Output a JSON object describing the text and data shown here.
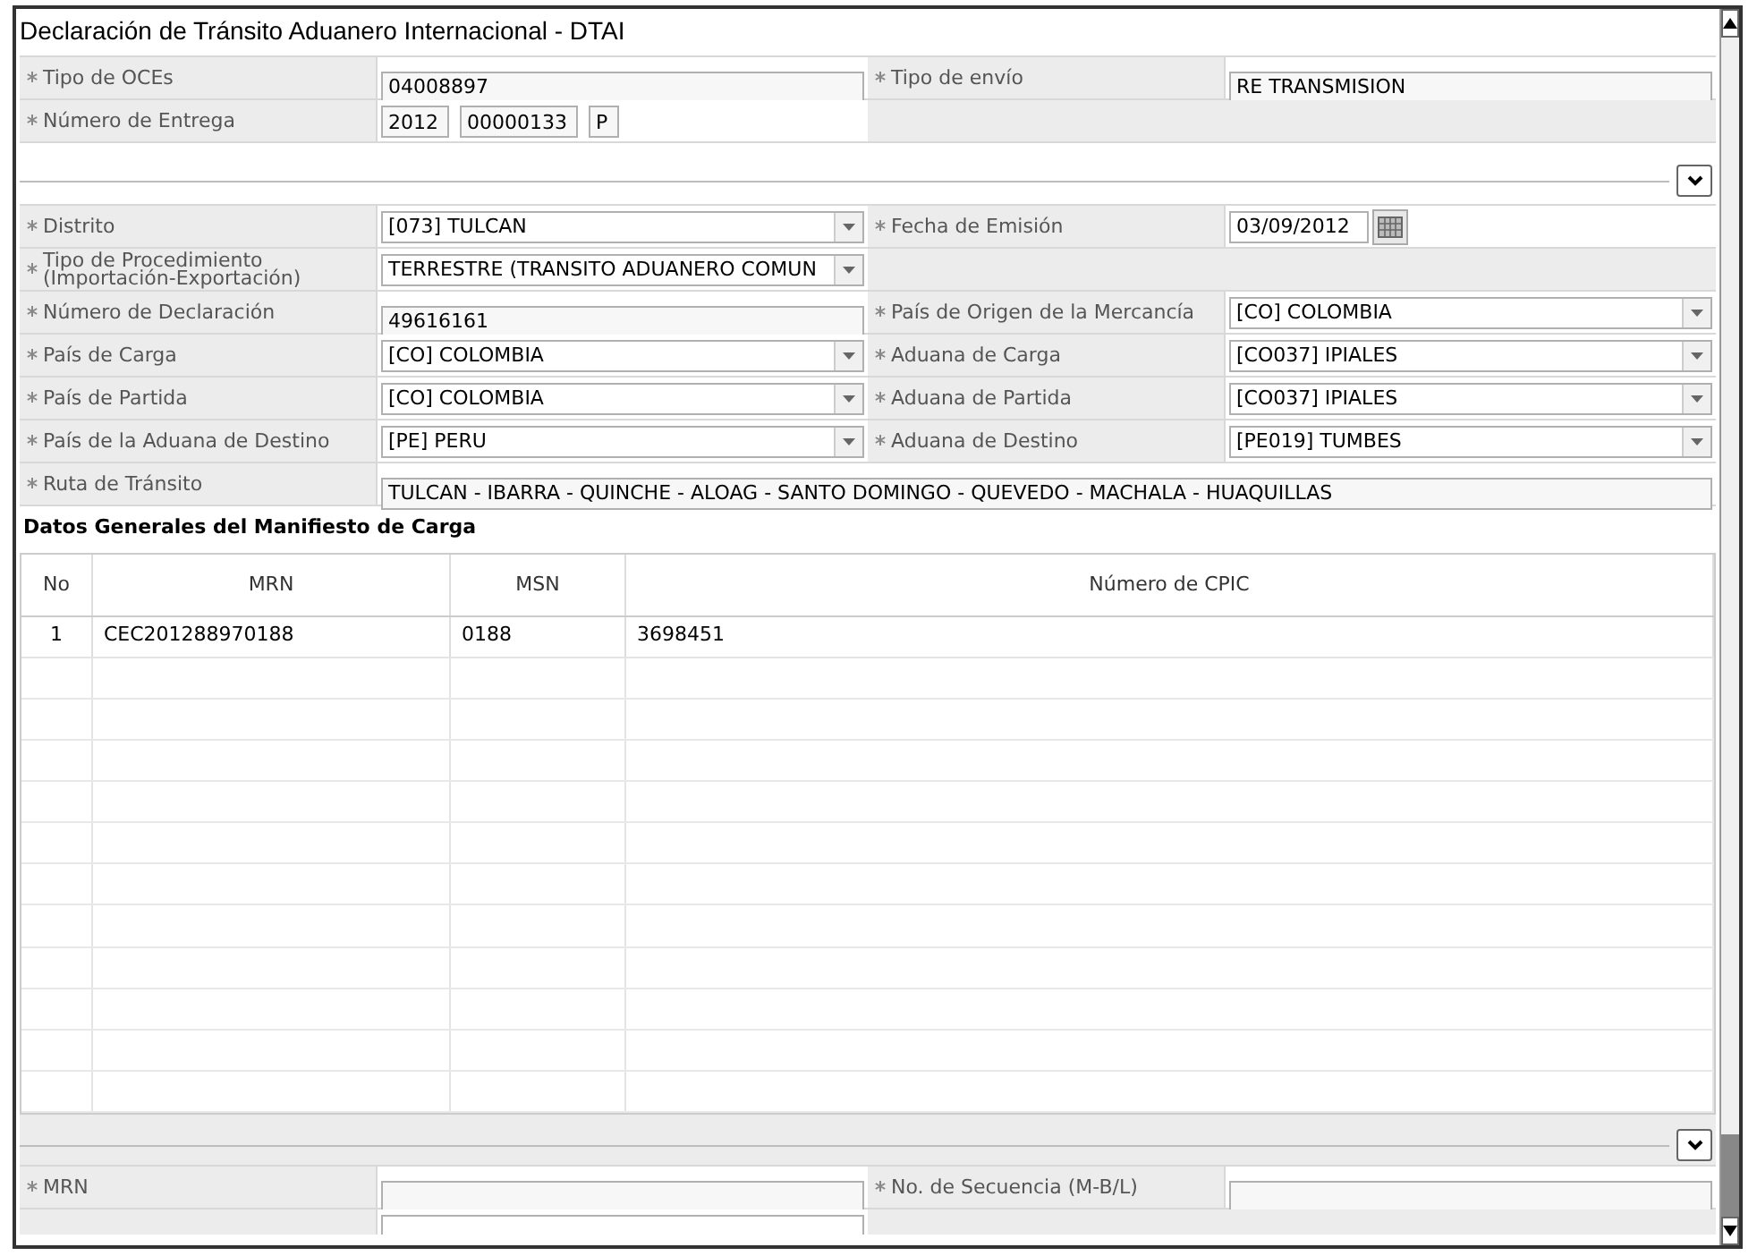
{
  "window": {
    "title": "Declaración de Tránsito Aduanero Internacional - DTAI"
  },
  "header_rows": [
    {
      "cells": [
        {
          "label": "Tipo de OCEs",
          "required": true,
          "kind": "text",
          "value": "04008897"
        },
        {
          "label": "Tipo de envío",
          "required": true,
          "kind": "text",
          "value": "RE TRANSMISION"
        }
      ]
    },
    {
      "cells": [
        {
          "label": "Número de Entrega",
          "required": true,
          "kind": "parts",
          "parts": [
            "2012",
            "00000133",
            "P"
          ]
        }
      ]
    }
  ],
  "detail_rows": [
    {
      "cells": [
        {
          "label": "Distrito",
          "required": true,
          "kind": "select",
          "value": "[073] TULCAN"
        },
        {
          "label": "Fecha de Emisión",
          "required": true,
          "kind": "date",
          "value": "03/09/2012"
        }
      ]
    },
    {
      "cells": [
        {
          "label": "Tipo de Procedimiento\n(Importación-Exportación)",
          "required": true,
          "kind": "select",
          "value": "TERRESTRE (TRANSITO ADUANERO COMUN"
        }
      ]
    },
    {
      "cells": [
        {
          "label": "Número de Declaración",
          "required": true,
          "kind": "text",
          "value": "49616161"
        },
        {
          "label": "País de Origen de la Mercancía",
          "required": true,
          "kind": "select",
          "value": "[CO] COLOMBIA"
        }
      ]
    },
    {
      "cells": [
        {
          "label": "País de Carga",
          "required": true,
          "kind": "select",
          "value": "[CO] COLOMBIA"
        },
        {
          "label": "Aduana de Carga",
          "required": true,
          "kind": "select",
          "value": "[CO037] IPIALES"
        }
      ]
    },
    {
      "cells": [
        {
          "label": "País de Partida",
          "required": true,
          "kind": "select",
          "value": "[CO] COLOMBIA"
        },
        {
          "label": "Aduana de Partida",
          "required": true,
          "kind": "select",
          "value": "[CO037] IPIALES"
        }
      ]
    },
    {
      "cells": [
        {
          "label": "País de la Aduana de Destino",
          "required": true,
          "kind": "select",
          "value": "[PE] PERU"
        },
        {
          "label": "Aduana de Destino",
          "required": true,
          "kind": "select",
          "value": "[PE019] TUMBES"
        }
      ]
    },
    {
      "cells": [
        {
          "label": "Ruta de Tránsito",
          "required": true,
          "kind": "wide",
          "value": "TULCAN - IBARRA - QUINCHE - ALOAG - SANTO DOMINGO - QUEVEDO - MACHALA - HUAQUILLAS"
        }
      ]
    }
  ],
  "manifest": {
    "title": "Datos Generales del Manifiesto de Carga",
    "columns": [
      "No",
      "MRN",
      "MSN",
      "Número de CPIC"
    ],
    "rows": [
      [
        "1",
        "CEC201288970188",
        "0188",
        "3698451"
      ]
    ]
  },
  "bottom_rows": [
    {
      "cells": [
        {
          "label": "MRN",
          "required": true,
          "kind": "text"
        },
        {
          "label": "No. de Secuencia (M-B/L)",
          "required": true,
          "kind": "text"
        }
      ]
    }
  ]
}
